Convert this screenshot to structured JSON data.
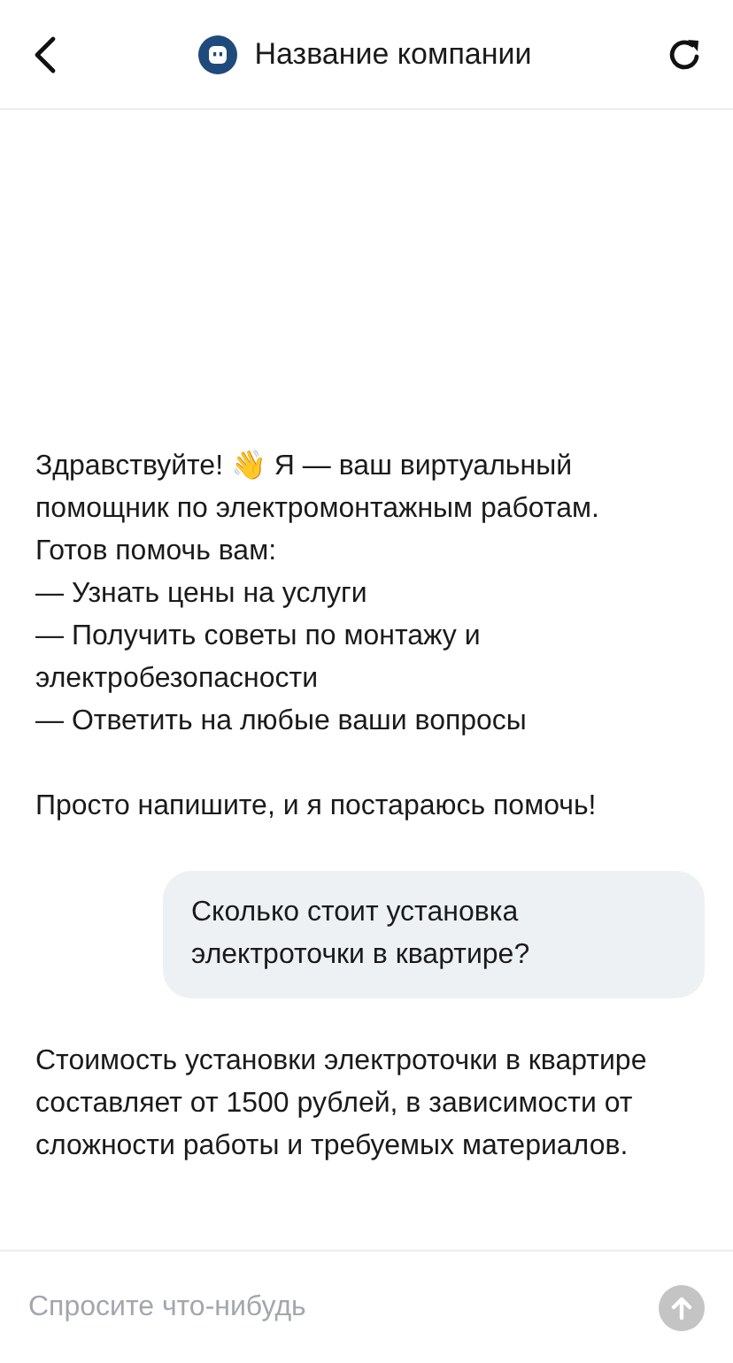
{
  "header": {
    "title": "Название компании"
  },
  "messages": [
    {
      "kind": "bot",
      "text": "Здравствуйте! 👋 Я — ваш виртуальный помощник по электромонтажным работам.\nГотов помочь вам:\n— Узнать цены на услуги\n— Получить советы по монтажу и электробезопасности\n— Ответить на любые ваши вопросы\n\nПросто напишите, и я постараюсь помочь!"
    },
    {
      "kind": "user",
      "text": "Сколько стоит установка электроточки в квартире?"
    },
    {
      "kind": "bot",
      "text": "Стоимость установки электроточки в квартире составляет от 1500 рублей, в зависимости от сложности работы и требуемых материалов."
    }
  ],
  "composer": {
    "placeholder": "Спросите что-нибудь"
  }
}
